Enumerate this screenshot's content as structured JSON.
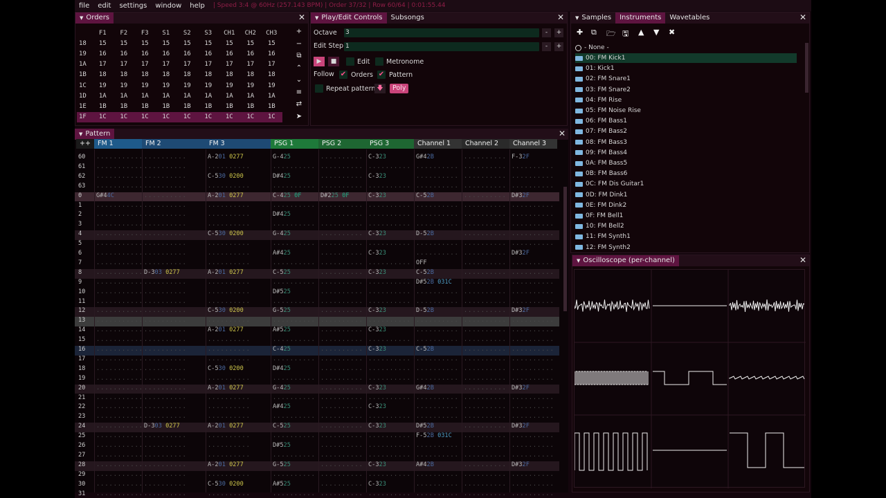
{
  "menu": {
    "file": "file",
    "edit": "edit",
    "settings": "settings",
    "window": "window",
    "help": "help",
    "status": "| Speed 3:4 @ 60Hz (257.143 BPM) | Order 37/32 | Row 60/64 | 0:01:55.44"
  },
  "orders": {
    "title": "Orders",
    "headers": [
      "",
      "F1",
      "F2",
      "F3",
      "S1",
      "S2",
      "S3",
      "CH1",
      "CH2",
      "CH3"
    ],
    "rows": [
      [
        "18",
        "15",
        "15",
        "15",
        "15",
        "15",
        "15",
        "15",
        "15",
        "15"
      ],
      [
        "19",
        "16",
        "16",
        "16",
        "16",
        "16",
        "16",
        "16",
        "16",
        "16"
      ],
      [
        "1A",
        "17",
        "17",
        "17",
        "17",
        "17",
        "17",
        "17",
        "17",
        "17"
      ],
      [
        "1B",
        "18",
        "18",
        "18",
        "18",
        "18",
        "18",
        "18",
        "18",
        "18"
      ],
      [
        "1C",
        "19",
        "19",
        "19",
        "19",
        "19",
        "19",
        "19",
        "19",
        "19"
      ],
      [
        "1D",
        "1A",
        "1A",
        "1A",
        "1A",
        "1A",
        "1A",
        "1A",
        "1A",
        "1A"
      ],
      [
        "1E",
        "1B",
        "1B",
        "1B",
        "1B",
        "1B",
        "1B",
        "1B",
        "1B",
        "1B"
      ],
      [
        "1F",
        "1C",
        "1C",
        "1C",
        "1C",
        "1C",
        "1C",
        "1C",
        "1C",
        "1C"
      ]
    ],
    "tools": [
      "+",
      "−",
      "⧉",
      "⌃",
      "⌄",
      "≡",
      "⇄",
      "➤"
    ]
  },
  "play": {
    "tab1": "Play/Edit Controls",
    "tab2": "Subsongs",
    "octave_label": "Octave",
    "octave_value": "3",
    "step_label": "Edit Step",
    "step_value": "1",
    "edit": "Edit",
    "metronome": "Metronome",
    "follow": "Follow",
    "orders": "Orders",
    "pattern": "Pattern",
    "repeat": "Repeat pattern",
    "poly": "Poly"
  },
  "samples": {
    "tab1": "Samples",
    "tab2": "Instruments",
    "tab3": "Wavetables",
    "none": "- None -",
    "items": [
      "00: FM Kick1",
      "01: Kick1",
      "02: FM Snare1",
      "03: FM Snare2",
      "04: FM Rise",
      "05: FM Noise Rise",
      "06: FM Bass1",
      "07: FM Bass2",
      "08: FM Bass3",
      "09: FM Bass4",
      "0A: FM Bass5",
      "0B: FM Bass6",
      "0C: FM Dis Guitar1",
      "0D: FM Dink1",
      "0E: FM Dink2",
      "0F: FM Bell1",
      "10: FM Bell2",
      "11: FM Synth1",
      "12: FM Synth2"
    ]
  },
  "pattern": {
    "title": "Pattern",
    "corner": "++",
    "channels": [
      "FM 1",
      "FM 2",
      "FM 3",
      "PSG 1",
      "PSG 2",
      "PSG 3",
      "Channel 1",
      "Channel 2",
      "Channel 3"
    ],
    "rows": [
      {
        "n": "60",
        "c": [
          null,
          null,
          [
            "A-2",
            "01",
            "0277"
          ],
          [
            "G-4",
            "25"
          ],
          null,
          [
            "C-3",
            "23"
          ],
          [
            "G#4",
            "2B"
          ],
          null,
          [
            "F-3",
            "2F"
          ]
        ]
      },
      {
        "n": "61",
        "c": []
      },
      {
        "n": "62",
        "c": [
          null,
          null,
          [
            "C-5",
            "30",
            "0200"
          ],
          [
            "D#4",
            "25"
          ],
          null,
          [
            "C-3",
            "23"
          ]
        ]
      },
      {
        "n": "63",
        "c": []
      },
      {
        "n": "0",
        "c": [
          [
            "G#4",
            "4C"
          ],
          null,
          [
            "A-2",
            "01",
            "0277"
          ],
          [
            "C-4",
            "25",
            "0F"
          ],
          [
            "D#2",
            "25",
            "0F"
          ],
          [
            "C-3",
            "23"
          ],
          [
            "C-5",
            "2B"
          ],
          null,
          [
            "D#3",
            "2F"
          ]
        ]
      },
      {
        "n": "1",
        "c": []
      },
      {
        "n": "2",
        "c": [
          null,
          null,
          null,
          [
            "D#4",
            "25"
          ]
        ]
      },
      {
        "n": "3",
        "c": []
      },
      {
        "n": "4",
        "c": [
          null,
          null,
          [
            "C-5",
            "30",
            "0200"
          ],
          [
            "G-4",
            "25"
          ],
          null,
          [
            "C-3",
            "23"
          ],
          [
            "D-5",
            "2B"
          ]
        ]
      },
      {
        "n": "5",
        "c": []
      },
      {
        "n": "6",
        "c": [
          null,
          null,
          null,
          [
            "A#4",
            "25"
          ],
          null,
          [
            "C-3",
            "23"
          ],
          null,
          null,
          [
            "D#3",
            "2F"
          ]
        ]
      },
      {
        "n": "7",
        "c": [
          null,
          null,
          null,
          null,
          null,
          null,
          [
            "OFF"
          ]
        ]
      },
      {
        "n": "8",
        "c": [
          null,
          [
            "D-3",
            "03",
            "0277"
          ],
          [
            "A-2",
            "01",
            "0277"
          ],
          [
            "C-5",
            "25"
          ],
          null,
          [
            "C-3",
            "23"
          ],
          [
            "C-5",
            "2B"
          ]
        ]
      },
      {
        "n": "9",
        "c": [
          null,
          null,
          null,
          null,
          null,
          null,
          [
            "D#5",
            "2B",
            "031C"
          ]
        ]
      },
      {
        "n": "10",
        "c": [
          null,
          null,
          null,
          [
            "D#5",
            "25"
          ]
        ]
      },
      {
        "n": "11",
        "c": []
      },
      {
        "n": "12",
        "c": [
          null,
          null,
          [
            "C-5",
            "30",
            "0200"
          ],
          [
            "G-5",
            "25"
          ],
          null,
          [
            "C-3",
            "23"
          ],
          [
            "D-5",
            "2B"
          ],
          null,
          [
            "D#3",
            "2F"
          ]
        ]
      },
      {
        "n": "13",
        "c": []
      },
      {
        "n": "14",
        "c": [
          null,
          null,
          [
            "A-2",
            "01",
            "0277"
          ],
          [
            "A#5",
            "25"
          ],
          null,
          [
            "C-3",
            "23"
          ]
        ]
      },
      {
        "n": "15",
        "c": []
      },
      {
        "n": "16",
        "c": [
          null,
          null,
          null,
          [
            "C-4",
            "25"
          ],
          null,
          [
            "C-3",
            "23"
          ],
          [
            "C-5",
            "2B"
          ]
        ]
      },
      {
        "n": "17",
        "c": []
      },
      {
        "n": "18",
        "c": [
          null,
          null,
          [
            "C-5",
            "30",
            "0200"
          ],
          [
            "D#4",
            "25"
          ]
        ]
      },
      {
        "n": "19",
        "c": []
      },
      {
        "n": "20",
        "c": [
          null,
          null,
          [
            "A-2",
            "01",
            "0277"
          ],
          [
            "G-4",
            "25"
          ],
          null,
          [
            "C-3",
            "23"
          ],
          [
            "G#4",
            "2B"
          ],
          null,
          [
            "D#3",
            "2F"
          ]
        ]
      },
      {
        "n": "21",
        "c": []
      },
      {
        "n": "22",
        "c": [
          null,
          null,
          null,
          [
            "A#4",
            "25"
          ],
          null,
          [
            "C-3",
            "23"
          ]
        ]
      },
      {
        "n": "23",
        "c": []
      },
      {
        "n": "24",
        "c": [
          null,
          [
            "D-3",
            "03",
            "0277"
          ],
          [
            "A-2",
            "01",
            "0277"
          ],
          [
            "C-5",
            "25"
          ],
          null,
          [
            "C-3",
            "23"
          ],
          [
            "D#5",
            "2B"
          ],
          null,
          [
            "D#3",
            "2F"
          ]
        ]
      },
      {
        "n": "25",
        "c": [
          null,
          null,
          null,
          null,
          null,
          null,
          [
            "F-5",
            "2B",
            "031C"
          ]
        ]
      },
      {
        "n": "26",
        "c": [
          null,
          null,
          null,
          [
            "D#5",
            "25"
          ]
        ]
      },
      {
        "n": "27",
        "c": []
      },
      {
        "n": "28",
        "c": [
          null,
          null,
          [
            "A-2",
            "01",
            "0277"
          ],
          [
            "G-5",
            "25"
          ],
          null,
          [
            "C-3",
            "23"
          ],
          [
            "A#4",
            "2B"
          ],
          null,
          [
            "D#3",
            "2F"
          ]
        ]
      },
      {
        "n": "29",
        "c": []
      },
      {
        "n": "30",
        "c": [
          null,
          null,
          [
            "C-5",
            "30",
            "0200"
          ],
          [
            "A#5",
            "25"
          ],
          null,
          [
            "C-3",
            "23"
          ]
        ]
      },
      {
        "n": "31",
        "c": []
      }
    ]
  },
  "osc": {
    "title": "Oscilloscope (per-channel)"
  },
  "colors": {
    "accent": "#5e1440",
    "fm": "#1e5a8a",
    "psg": "#1e7a3a",
    "noise": "#3a3a3a"
  }
}
